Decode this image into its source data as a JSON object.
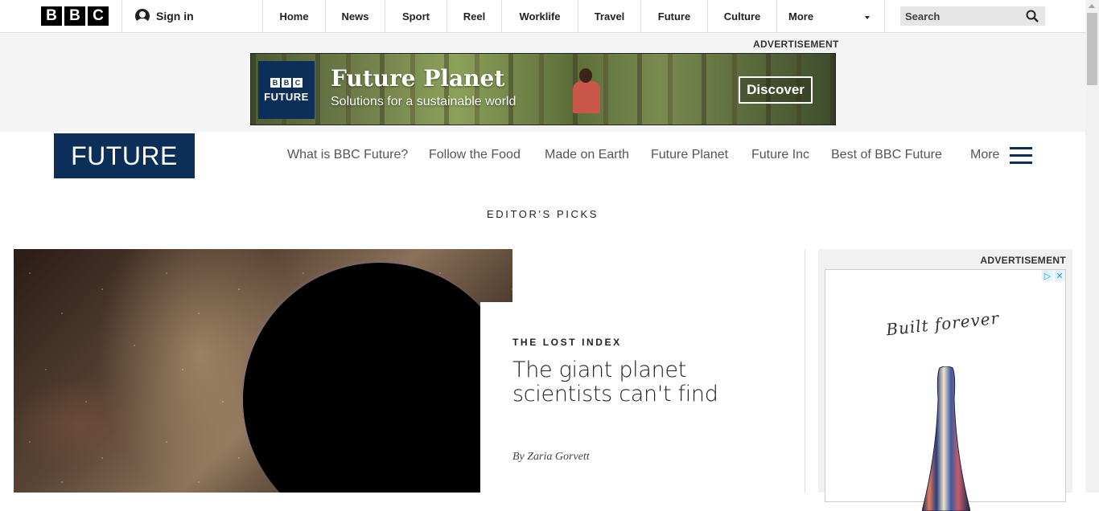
{
  "global_nav": {
    "logo_letters": [
      "B",
      "B",
      "C"
    ],
    "sign_in": "Sign in",
    "items": [
      "Home",
      "News",
      "Sport",
      "Reel",
      "Worklife",
      "Travel",
      "Future",
      "Culture"
    ],
    "more": "More",
    "search_placeholder": "Search"
  },
  "top_ad": {
    "label": "ADVERTISEMENT",
    "brand_letters": [
      "B",
      "B",
      "C"
    ],
    "brand_name": "FUTURE",
    "title": "Future Planet",
    "subtitle": "Solutions for a sustainable world",
    "cta": "Discover"
  },
  "section_header": {
    "logo": "FUTURE",
    "nav": [
      "What is BBC Future?",
      "Follow the Food",
      "Made on Earth",
      "Future Planet",
      "Future Inc",
      "Best of BBC Future"
    ],
    "more": "More"
  },
  "editors_picks": {
    "heading": "EDITOR'S PICKS",
    "kicker": "THE LOST INDEX",
    "headline": "The giant planet scientists can't find",
    "byline": "By Zaria Gorvett"
  },
  "side_ad": {
    "label": "ADVERTISEMENT",
    "signature": "Built forever"
  },
  "colors": {
    "future_navy": "#0b2f58",
    "bbc_black": "#000000",
    "divider": "#dddddd"
  }
}
